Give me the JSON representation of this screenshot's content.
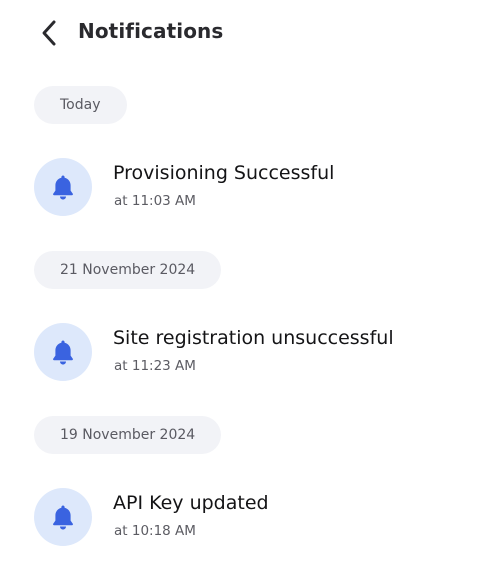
{
  "header": {
    "title": "Notifications",
    "back_icon": "chevron-left-icon"
  },
  "groups": [
    {
      "date": "Today",
      "items": [
        {
          "icon": "bell-icon",
          "title": "Provisioning Successful",
          "time": "at 11:03 AM"
        }
      ]
    },
    {
      "date": "21 November 2024",
      "items": [
        {
          "icon": "bell-icon",
          "title": "Site registration unsuccessful",
          "time": "at 11:23 AM"
        }
      ]
    },
    {
      "date": "19 November 2024",
      "items": [
        {
          "icon": "bell-icon",
          "title": "API Key updated",
          "time": "at 10:18 AM"
        }
      ]
    }
  ],
  "colors": {
    "accent": "#3a63e0",
    "icon_background": "#dde8fb",
    "chip_background": "#f2f3f7"
  }
}
